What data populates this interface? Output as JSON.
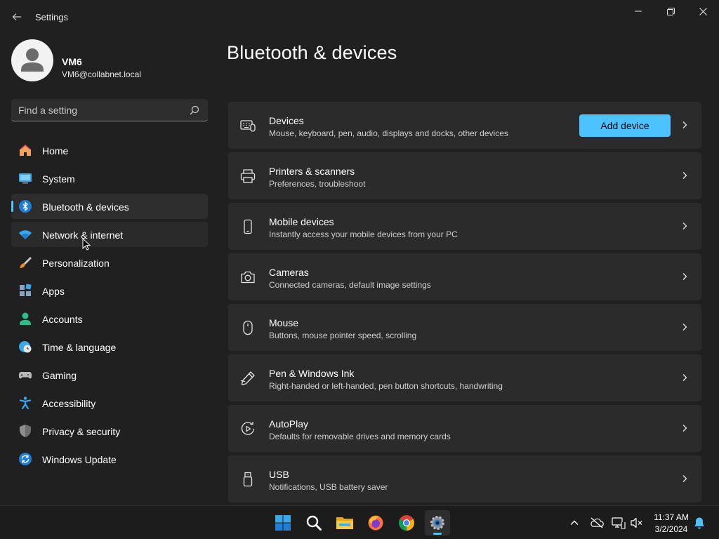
{
  "window": {
    "title": "Settings"
  },
  "profile": {
    "name": "VM6",
    "email": "VM6@collabnet.local"
  },
  "search": {
    "placeholder": "Find a setting"
  },
  "nav": {
    "items": [
      {
        "label": "Home",
        "icon": "home-icon"
      },
      {
        "label": "System",
        "icon": "system-icon"
      },
      {
        "label": "Bluetooth & devices",
        "icon": "bluetooth-icon",
        "selected": true
      },
      {
        "label": "Network & internet",
        "icon": "wifi-icon",
        "hovered": true
      },
      {
        "label": "Personalization",
        "icon": "brush-icon"
      },
      {
        "label": "Apps",
        "icon": "apps-icon"
      },
      {
        "label": "Accounts",
        "icon": "accounts-icon"
      },
      {
        "label": "Time & language",
        "icon": "clock-globe-icon"
      },
      {
        "label": "Gaming",
        "icon": "gamepad-icon"
      },
      {
        "label": "Accessibility",
        "icon": "accessibility-icon"
      },
      {
        "label": "Privacy & security",
        "icon": "shield-icon"
      },
      {
        "label": "Windows Update",
        "icon": "update-icon"
      }
    ]
  },
  "main": {
    "title": "Bluetooth & devices",
    "cards": [
      {
        "title": "Devices",
        "subtitle": "Mouse, keyboard, pen, audio, displays and docks, other devices",
        "icon": "devices-icon",
        "button": "Add device"
      },
      {
        "title": "Printers & scanners",
        "subtitle": "Preferences, troubleshoot",
        "icon": "printer-icon"
      },
      {
        "title": "Mobile devices",
        "subtitle": "Instantly access your mobile devices from your PC",
        "icon": "phone-icon"
      },
      {
        "title": "Cameras",
        "subtitle": "Connected cameras, default image settings",
        "icon": "camera-icon"
      },
      {
        "title": "Mouse",
        "subtitle": "Buttons, mouse pointer speed, scrolling",
        "icon": "mouse-icon"
      },
      {
        "title": "Pen & Windows Ink",
        "subtitle": "Right-handed or left-handed, pen button shortcuts, handwriting",
        "icon": "pen-icon"
      },
      {
        "title": "AutoPlay",
        "subtitle": "Defaults for removable drives and memory cards",
        "icon": "autoplay-icon"
      },
      {
        "title": "USB",
        "subtitle": "Notifications, USB battery saver",
        "icon": "usb-icon"
      }
    ]
  },
  "taskbar": {
    "apps": [
      "start-icon",
      "search-icon",
      "file-explorer-icon",
      "firefox-icon",
      "chrome-icon",
      "settings-icon"
    ],
    "active_app": "settings-icon",
    "tray": [
      "chevron-up-icon",
      "onedrive-icon",
      "network-icon",
      "volume-muted-icon",
      "notification-bell-icon"
    ],
    "time": "11:37 AM",
    "date": "3/2/2024"
  },
  "colors": {
    "accent": "#4cc2ff",
    "background": "#202020",
    "card": "#2b2b2b"
  }
}
